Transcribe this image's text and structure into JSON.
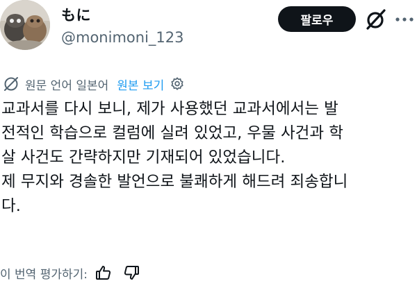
{
  "profile": {
    "display_name": "もに",
    "handle": "@monimoni_123"
  },
  "actions": {
    "follow_label": "팔로우"
  },
  "translation": {
    "source_language": "원문 언어 일본어",
    "show_original_label": "원본 보기"
  },
  "post": {
    "lines": [
      "교과서를 다시 보니, 제가 사용했던 교과서에서는 발",
      "전적인 학습으로 컬럼에 실려 있었고, 우물 사건과 학",
      "살 사건도 간략하지만 기재되어 있었습니다.",
      "제 무지와 경솔한 발언으로 불쾌하게 해드려 죄송합니",
      "다."
    ]
  },
  "rating": {
    "prompt": "이 번역 평가하기:"
  },
  "colors": {
    "text_primary": "#0f1419",
    "text_secondary": "#536471",
    "link_blue": "#1d9bf0",
    "button_dark": "#0f1419"
  },
  "icons": {
    "avatar": "plush-toys-avatar",
    "grok": "grok-slash-icon",
    "more": "more-dots-icon",
    "translate": "globe-slash-icon",
    "settings": "gear-icon",
    "thumbs_up": "thumbs-up-icon",
    "thumbs_down": "thumbs-down-icon"
  }
}
